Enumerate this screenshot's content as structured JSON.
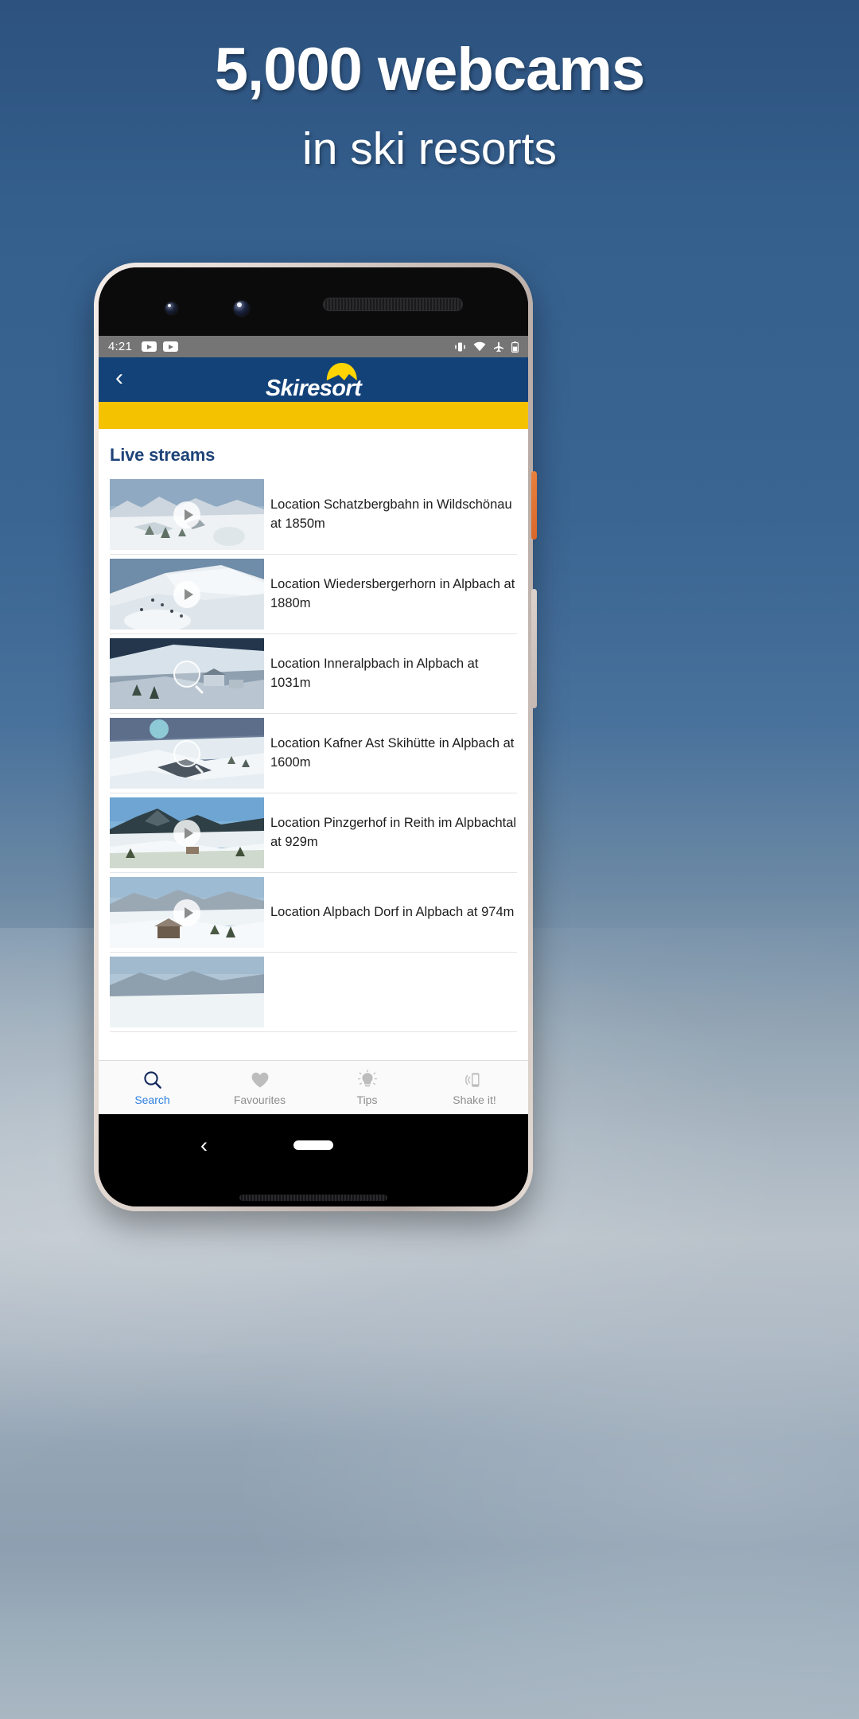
{
  "promo": {
    "headline": "5,000 webcams",
    "subtitle": "in ski resorts"
  },
  "colors": {
    "brand_blue": "#134279",
    "brand_yellow": "#f5c200",
    "accent_active": "#2f7fe0",
    "heading_blue": "#1e4378",
    "statusbar_gray": "#757575"
  },
  "phone": {
    "status_bar": {
      "time": "4:21",
      "notification_icons": [
        "youtube-icon",
        "youtube-icon"
      ],
      "system_icons": [
        "vibrate-icon",
        "wifi-icon",
        "airplane-mode-icon",
        "battery-icon"
      ]
    },
    "gesture_nav": {
      "back": "back-chevron-icon",
      "home": "home-pill-icon"
    },
    "hardware": {
      "power_button": "power-button",
      "volume_button": "volume-button"
    }
  },
  "app": {
    "header": {
      "back_label": "‹",
      "logo_text": "Skiresort"
    },
    "content": {
      "section_title": "Live streams",
      "streams": [
        {
          "caption": "Location Schatzbergbahn in Wildschönau at 1850m",
          "overlay": "play",
          "thumb_style": "alpine-panorama-snowy-peaks"
        },
        {
          "caption": "Location Wiedersbergerhorn in Alpbach at 1880m",
          "overlay": "play",
          "thumb_style": "ski-slope-with-skiers"
        },
        {
          "caption": "Location Inneralpbach in Alpbach at 1031m",
          "overlay": "magnifier",
          "thumb_style": "valley-village-dusk"
        },
        {
          "caption": "Location Kafner Ast Skihütte in Alpbach at 1600m",
          "overlay": "magnifier",
          "thumb_style": "snowy-ridge-sunlit"
        },
        {
          "caption": "Location Pinzgerhof in Reith im Alpbachtal at 929m",
          "overlay": "play",
          "thumb_style": "mountain-meadow-blue-sky"
        },
        {
          "caption": "Location Alpbach Dorf in Alpbach at 974m",
          "overlay": "play",
          "thumb_style": "village-field-snow"
        },
        {
          "caption": "",
          "overlay": "none",
          "thumb_style": "mountain-ridge-partial"
        }
      ]
    },
    "tabs": [
      {
        "label": "Search",
        "icon": "search-icon",
        "active": true
      },
      {
        "label": "Favourites",
        "icon": "heart-icon",
        "active": false
      },
      {
        "label": "Tips",
        "icon": "lightbulb-icon",
        "active": false
      },
      {
        "label": "Shake it!",
        "icon": "shake-phone-icon",
        "active": false
      }
    ]
  }
}
